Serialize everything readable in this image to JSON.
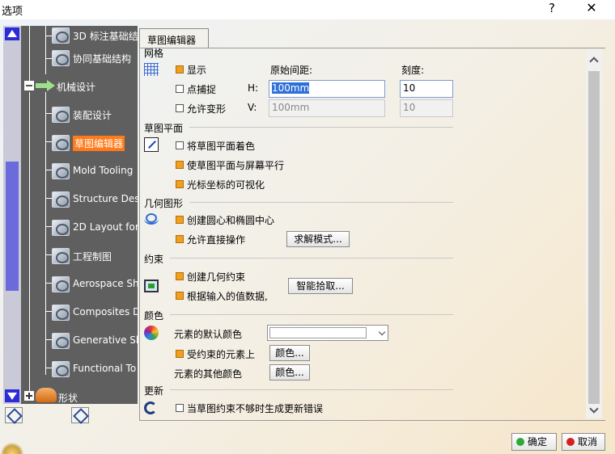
{
  "window": {
    "title": "选项",
    "help": "?",
    "close": "✕"
  },
  "tree": {
    "items": [
      {
        "label": "3D 标注基础结",
        "kind": "child"
      },
      {
        "label": "协同基础结构",
        "kind": "child"
      },
      {
        "label": "机械设计",
        "kind": "group"
      },
      {
        "label": "装配设计",
        "kind": "child"
      },
      {
        "label": "草图编辑器",
        "kind": "child",
        "selected": true
      },
      {
        "label": "Mold Tooling",
        "kind": "child"
      },
      {
        "label": "Structure Des",
        "kind": "child"
      },
      {
        "label": "2D Layout for",
        "kind": "child"
      },
      {
        "label": "工程制图",
        "kind": "child"
      },
      {
        "label": "Aerospace Sh",
        "kind": "child"
      },
      {
        "label": "Composites D",
        "kind": "child"
      },
      {
        "label": "Generative Sh",
        "kind": "child"
      },
      {
        "label": "Functional To",
        "kind": "child"
      },
      {
        "label": "形状",
        "kind": "group"
      }
    ]
  },
  "tab": {
    "label": "草图编辑器"
  },
  "grid": {
    "section": "网格",
    "show_label": "显示",
    "show_checked": true,
    "snap_label": "点捕捉",
    "snap_checked": false,
    "distort_label": "允许变形",
    "distort_checked": false,
    "spacing_header": "原始间距:",
    "graduations_header": "刻度:",
    "h_label": "H:",
    "h_value": "100mm",
    "h_grad": "10",
    "v_label": "V:",
    "v_value": "100mm",
    "v_grad": "10"
  },
  "sketch_plane": {
    "section": "草图平面",
    "shade_label": "将草图平面着色",
    "shade_checked": false,
    "parallel_label": "使草图平面与屏幕平行",
    "parallel_checked": true,
    "cursor_label": "光标坐标的可视化",
    "cursor_checked": true
  },
  "geometry": {
    "section": "几何图形",
    "centers_label": "创建圆心和椭圆中心",
    "centers_checked": true,
    "direct_label": "允许直接操作",
    "direct_checked": true,
    "solve_button": "求解模式..."
  },
  "constraint": {
    "section": "约束",
    "geo_label": "创建几何约束",
    "geo_checked": true,
    "dim_label": "根据输入的值数据,",
    "dim_checked": true,
    "smart_button": "智能拾取..."
  },
  "colors": {
    "section": "颜色",
    "default_label": "元素的默认颜色",
    "constrained_label": "受约束的元素上",
    "constrained_checked": true,
    "constrained_button": "颜色...",
    "other_label": "元素的其他颜色",
    "other_button": "颜色..."
  },
  "update": {
    "section": "更新",
    "error_label": "当草图约束不够时生成更新错误",
    "error_checked": false
  },
  "footer": {
    "ok": "确定",
    "cancel": "取消",
    "ok_color": "#2ea83a",
    "cancel_color": "#d42020"
  }
}
